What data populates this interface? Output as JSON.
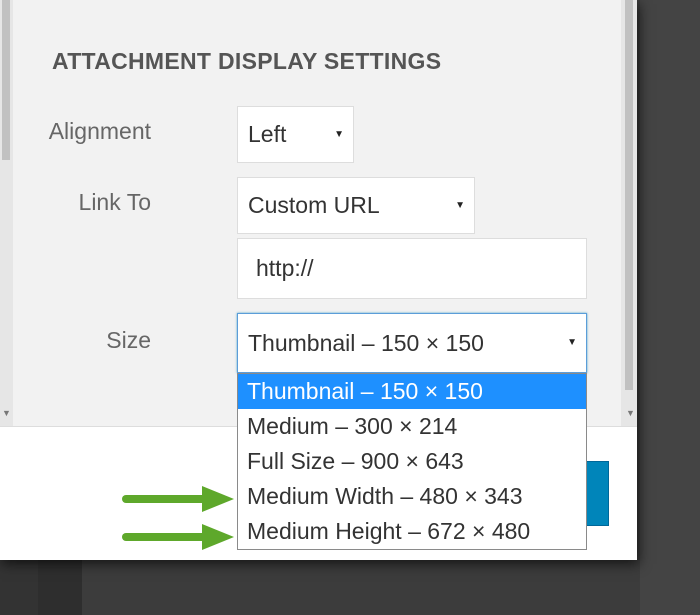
{
  "panel": {
    "heading": "ATTACHMENT DISPLAY SETTINGS"
  },
  "alignment": {
    "label": "Alignment",
    "value": "Left"
  },
  "link_to": {
    "label": "Link To",
    "value": "Custom URL",
    "url_value": "http://"
  },
  "size": {
    "label": "Size",
    "value": "Thumbnail – 150 × 150",
    "options": [
      "Thumbnail – 150 × 150",
      "Medium – 300 × 214",
      "Full Size – 900 × 643",
      "Medium Width – 480 × 343",
      "Medium Height – 672 × 480"
    ],
    "highlighted_index": 0
  },
  "icons": {
    "caret": "caret-down-icon",
    "annotation": "green-arrow-icon"
  },
  "colors": {
    "selected_option": "#1e90ff",
    "primary_button": "#0085ba",
    "annotation_arrow": "#5ea82b"
  }
}
